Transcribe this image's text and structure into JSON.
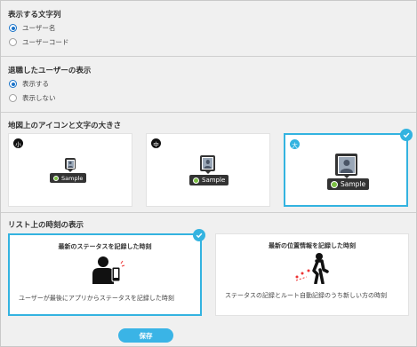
{
  "display_string": {
    "title": "表示する文字列",
    "options": [
      {
        "label": "ユーザー名",
        "selected": true
      },
      {
        "label": "ユーザーコード",
        "selected": false
      }
    ]
  },
  "retired_users": {
    "title": "退職したユーザーの表示",
    "options": [
      {
        "label": "表示する",
        "selected": true
      },
      {
        "label": "表示しない",
        "selected": false
      }
    ]
  },
  "map_icon_size": {
    "title": "地図上のアイコンと文字の大きさ",
    "options": [
      {
        "size": "小",
        "label": "Sample",
        "selected": false
      },
      {
        "size": "中",
        "label": "Sample",
        "selected": false
      },
      {
        "size": "大",
        "label": "Sample",
        "selected": true
      }
    ]
  },
  "list_time": {
    "title": "リスト上の時刻の表示",
    "options": [
      {
        "title": "最新のステータスを記録した時刻",
        "description": "ユーザーが最後にアプリからステータスを記録した時刻",
        "selected": true
      },
      {
        "title": "最新の位置情報を記録した時刻",
        "description": "ステータスの記録とルート自動記録のうち新しい方の時刻",
        "selected": false
      }
    ]
  },
  "save_label": "保存",
  "colors": {
    "accent": "#33b3e0",
    "radio": "#1a73c9",
    "label_dot": "#7bc043"
  }
}
